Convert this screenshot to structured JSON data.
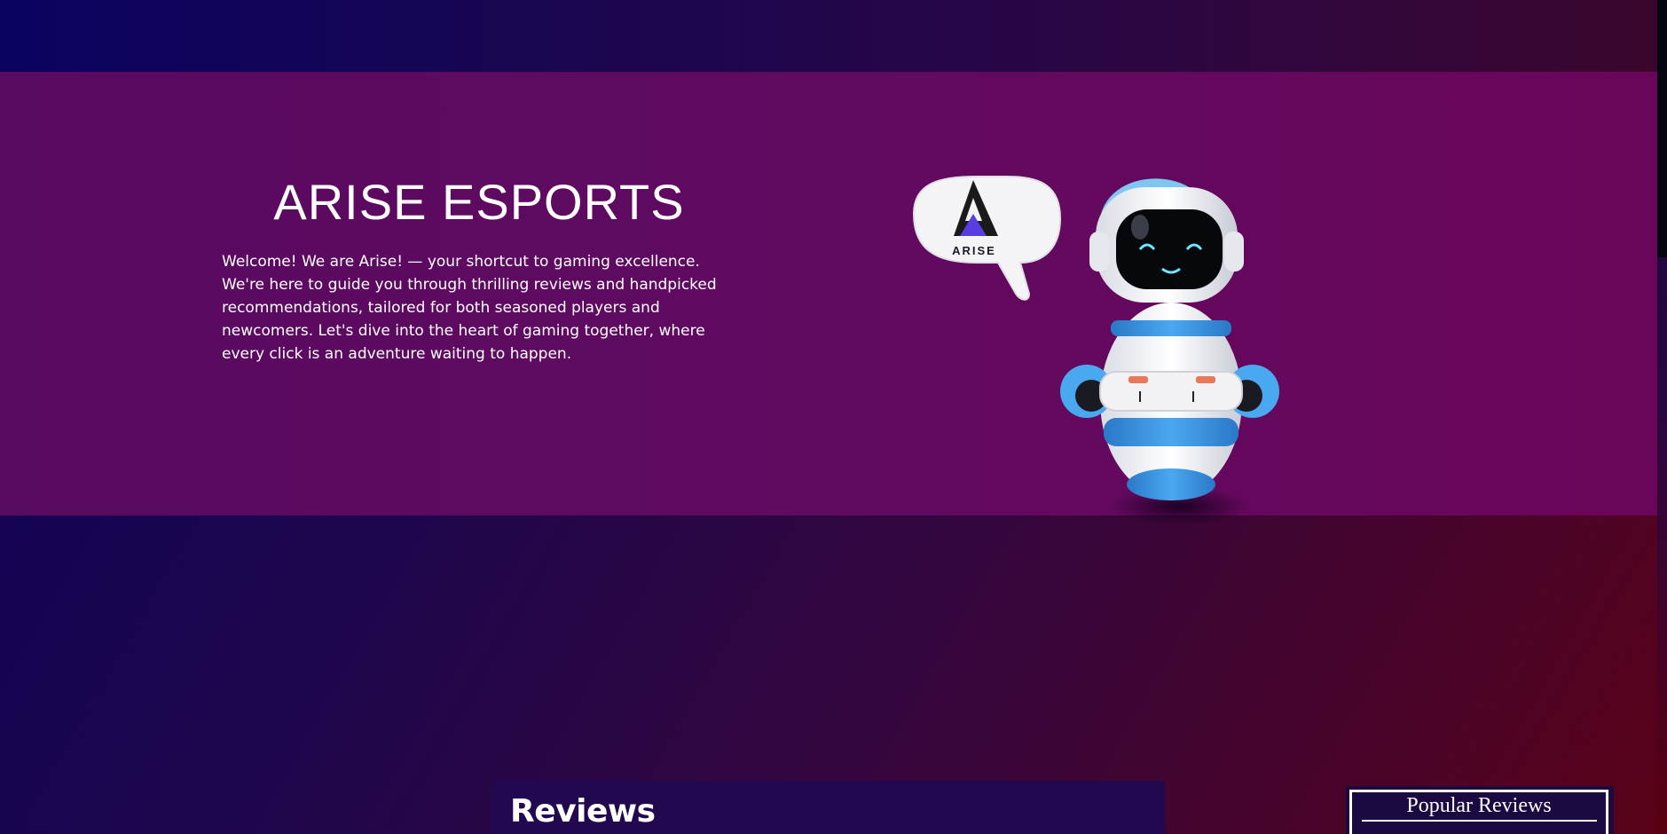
{
  "hero": {
    "title": "ARISE ESPORTS",
    "description": "Welcome! We are Arise! — your shortcut to gaming excellence. We're here to guide you through thrilling reviews and handpicked recommendations, tailored for both seasoned players and newcomers. Let's dive into the heart of gaming together, where every click is an adventure waiting to happen.",
    "bubble_logo_text": "ARISE",
    "mascot_icon": "robot-gamer-icon"
  },
  "reviews": {
    "heading": "Reviews"
  },
  "popular": {
    "title": "Popular Reviews"
  },
  "colors": {
    "hero_bg": "#600a60",
    "page_bg_start": "#0e0258",
    "page_bg_end": "#5a0218",
    "accent_blue": "#3aa0e8",
    "logo_purple": "#5a3de0"
  }
}
